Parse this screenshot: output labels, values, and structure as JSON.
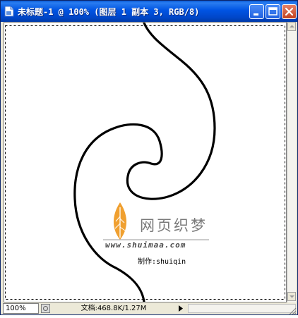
{
  "window": {
    "title": "未标题-1 @ 100% (图层 1 副本 3, RGB/8)",
    "controls": {
      "minimize": "minimize",
      "maximize": "maximize",
      "close": "close"
    }
  },
  "canvas": {
    "watermark": {
      "brand_text": "网页织梦",
      "url_text": "www.shuimaa.com",
      "credit_text": "制作:shuiqin"
    }
  },
  "status": {
    "zoom": "100%",
    "doc_info": "文档:468.8K/1.27M"
  },
  "colors": {
    "titlebar": "#0054e3",
    "close_button": "#c2421f",
    "leaf_orange": "#f0a030"
  }
}
